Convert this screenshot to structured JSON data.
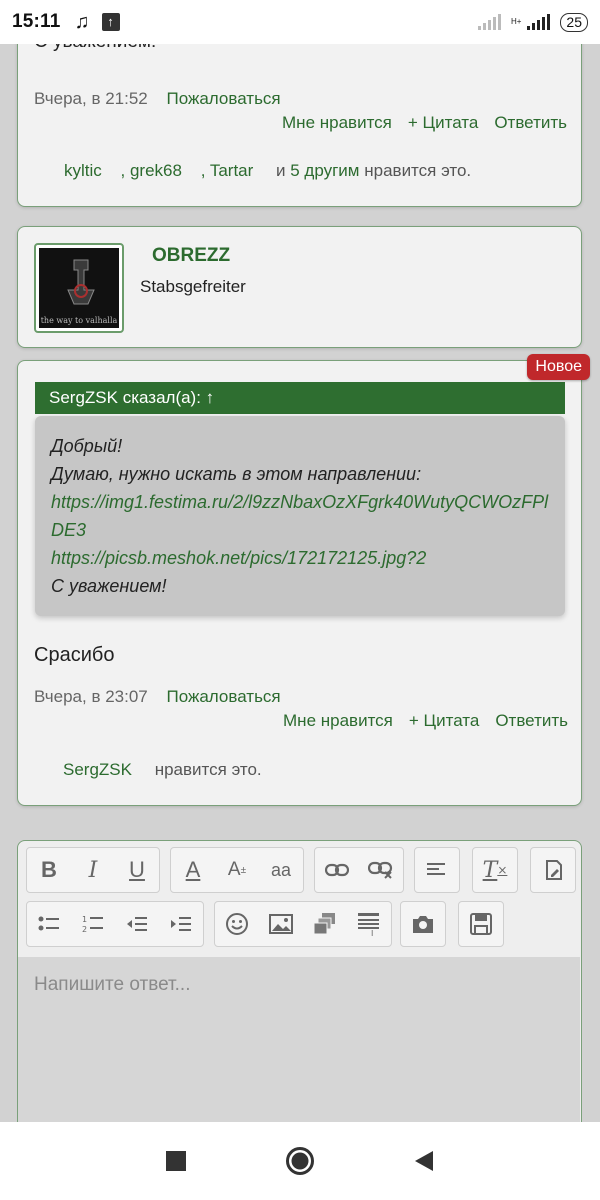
{
  "status_bar": {
    "time": "15:11",
    "network": "H+",
    "battery": "25"
  },
  "post1": {
    "cut_text": "С уважением!",
    "date": "Вчера, в 21:52",
    "report": "Пожаловаться",
    "actions": {
      "like": "Мне нравится",
      "quote": "+ Цитата",
      "reply": "Ответить"
    },
    "likers": [
      "kyltic",
      ", grek68",
      ", Tartar"
    ],
    "likers_more_prefix": "и",
    "likers_more": "5 другим",
    "likers_suffix": "нравится это."
  },
  "author": {
    "name": "OBREZZ",
    "rank": "Stabsgefreiter",
    "avatar_caption": "the way to valhalla"
  },
  "post2": {
    "badge": "Новое",
    "quote_header": "SergZSK сказал(а): ↑",
    "quote_lines": {
      "l1": "Добрый!",
      "l2": "Думаю, нужно искать в этом направлении:",
      "link1": "https://img1.festima.ru/2/l9zzNbaxOzXFgrk40WutyQCWOzFPlDE3",
      "link2": "https://picsb.meshok.net/pics/172172125.jpg?2",
      "l5": "С уважением!"
    },
    "text": "Срасибо",
    "date": "Вчера, в 23:07",
    "report": "Пожаловаться",
    "actions": {
      "like": "Мне нравится",
      "quote": "+ Цитата",
      "reply": "Ответить"
    },
    "liker": "SergZSK",
    "likers_suffix": "нравится это."
  },
  "editor": {
    "placeholder": "Напишите ответ...",
    "toolbar": {
      "bold": "B",
      "italic": "I",
      "underline": "U",
      "font_color": "A",
      "font_size": "A",
      "font_case": "aa"
    }
  },
  "colors": {
    "accent": "#2c6b2f",
    "quote_header": "#2e6e30",
    "badge": "#c0282b"
  }
}
